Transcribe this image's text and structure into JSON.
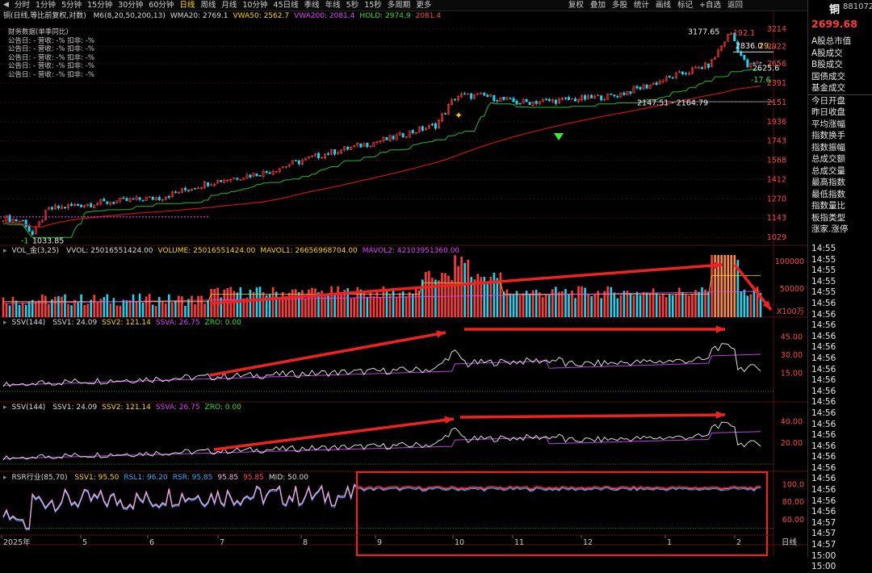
{
  "toolbar": {
    "periods": [
      "分时",
      "1分钟",
      "5分钟",
      "15分钟",
      "30分钟",
      "60分钟",
      "日线",
      "周线",
      "月线",
      "10分钟",
      "45日线",
      "季线",
      "年线",
      "5秒",
      "15秒",
      "多周期",
      "更多"
    ],
    "active_period": "日线",
    "right_tools": [
      "复权",
      "叠加",
      "多股",
      "统计",
      "画线",
      "标记",
      "+自选",
      "返回"
    ]
  },
  "right_panel": {
    "name": "铜",
    "code": "881072",
    "price": "2699.68",
    "items": [
      "A股总市值",
      "A股成交",
      "B股成交",
      "国债成交",
      "基金成交",
      "今日开盘",
      "昨日收盘",
      "平均涨幅",
      "指数换手",
      "指数振幅",
      "总成交额",
      "总成交量",
      "最高指数",
      "最低指数",
      "指数量比",
      "板指类型",
      "涨家.涨停"
    ],
    "times": [
      "14:55",
      "14:55",
      "14:55",
      "14:55",
      "14:55",
      "14:56",
      "14:56",
      "14:56",
      "14:56",
      "14:56",
      "14:56",
      "14:56",
      "14:56",
      "14:56",
      "14:56",
      "14:56",
      "14:56",
      "14:56",
      "14:56",
      "14:56",
      "14:56",
      "14:56",
      "14:56",
      "14:56",
      "14:56",
      "14:57",
      "14:57",
      "14:57",
      "15:00",
      "15:00"
    ]
  },
  "main": {
    "title": "铜(日线,等比前复权,对数)",
    "indicators": [
      {
        "text": "M6(8,20,50,200,13)",
        "color": "#dddddd"
      },
      {
        "text": "WMA20: 2769.1",
        "color": "#dddddd"
      },
      {
        "text": "VWA50: 2562.7",
        "color": "#ffd400"
      },
      {
        "text": "VWA200: 2081.4",
        "color": "#e040fb"
      },
      {
        "text": "HOLD: 2974.9",
        "color": "#33dd33"
      },
      {
        "text": "2081.4",
        "color": "#ff4444"
      }
    ],
    "fin_title": "财务数据(单季同比)",
    "fin_rows": [
      "公告日: -    营收: -%    扣非: -%",
      "公告日: -    营收: -%    扣非: -%",
      "公告日: -    营收: -%    扣非: -%",
      "公告日: -    营收: -%    扣非: -%",
      "公告日: -    营收: -%    扣非: -%"
    ],
    "y_ticks": [
      "3214",
      "2922",
      "2656",
      "2391",
      "2151",
      "1936",
      "1743",
      "1568",
      "1412",
      "1270",
      "1143",
      "1029"
    ],
    "annotations": {
      "high": "3177.65",
      "high_pct": "192.1",
      "mid1": "2836.0",
      "mid1b": "29...",
      "low_right": "2625.6",
      "neg": "-17.6",
      "range": "2147.51 - 2164.79",
      "low": "1033.85",
      "low_pct": "-1"
    }
  },
  "vol": {
    "title": "VOL_金(3,25)",
    "items": [
      {
        "text": "VVOL: 25016551424.00",
        "color": "#dddddd"
      },
      {
        "text": "VOLUME: 25016551424.00",
        "color": "#ffd400"
      },
      {
        "text": "MAVOL1: 26656968704.00",
        "color": "#ffd400"
      },
      {
        "text": "MAVOL2: 42103951360.00",
        "color": "#e040fb"
      }
    ],
    "y_ticks": [
      "100000",
      "50000"
    ],
    "unit": "X100万"
  },
  "ssv1": {
    "title": "SSV(144)",
    "items": [
      {
        "text": "SSV1: 24.09",
        "color": "#dddddd"
      },
      {
        "text": "SSV2: 121.14",
        "color": "#ffd400"
      },
      {
        "text": "SSVA: 26.75",
        "color": "#e040fb"
      },
      {
        "text": "ZRO: 0.00",
        "color": "#33dd33"
      }
    ],
    "y_ticks": [
      "45.00",
      "30.00",
      "15.00"
    ]
  },
  "ssv2": {
    "title": "SSV(144)",
    "items": [
      {
        "text": "SSV1: 24.09",
        "color": "#dddddd"
      },
      {
        "text": "SSV2: 121.14",
        "color": "#ffd400"
      },
      {
        "text": "SSVA: 26.75",
        "color": "#e040fb"
      },
      {
        "text": "ZRO: 0.00",
        "color": "#33dd33"
      }
    ],
    "y_ticks": [
      "40.00",
      "20.00"
    ]
  },
  "rsr": {
    "title": "RSR行业(85,70)",
    "items": [
      {
        "text": "SSV1: 95.50",
        "color": "#ffd400"
      },
      {
        "text": "RSL1: 96.20",
        "color": "#33aaff"
      },
      {
        "text": "RSR: 95.85",
        "color": "#33aaff"
      },
      {
        "text": "95.85",
        "color": "#ffb0e0"
      },
      {
        "text": "95.85",
        "color": "#ff4444"
      },
      {
        "text": "MID: 50.00",
        "color": "#dddddd"
      }
    ],
    "y_ticks": [
      "100.0",
      "80.00",
      "60.00"
    ]
  },
  "x_axis": {
    "labels": [
      "2025年",
      "5",
      "6",
      "7",
      "8",
      "9",
      "10",
      "11",
      "12",
      "1",
      "2"
    ],
    "period": "日线"
  },
  "colors": {
    "up": "#ff3b3b",
    "down": "#22d3ee",
    "accent": "#ffd400",
    "ma_green": "#22bb22",
    "ma_red": "#cc1111"
  }
}
